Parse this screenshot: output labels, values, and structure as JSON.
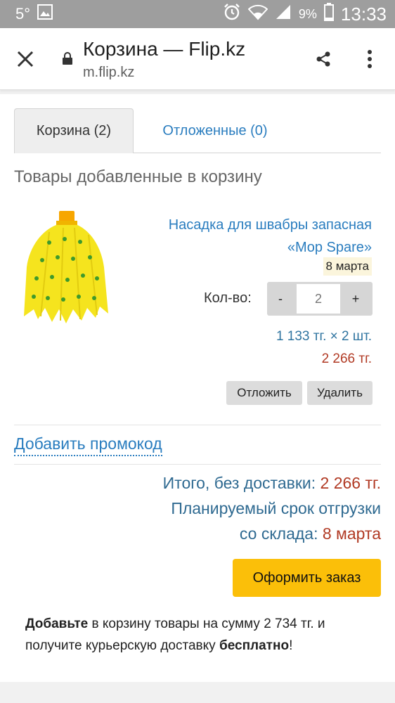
{
  "status_bar": {
    "temperature": "5°",
    "battery": "9%",
    "time": "13:33"
  },
  "header": {
    "title": "Корзина — Flip.kz",
    "url": "m.flip.kz"
  },
  "tabs": [
    {
      "label": "Корзина (2)",
      "active": true
    },
    {
      "label": "Отложенные (0)",
      "active": false
    }
  ],
  "cart": {
    "heading": "Товары добавленные в корзину",
    "items": [
      {
        "name": "Насадка для швабры запасная «Mop Spare»",
        "delivery_date": "8 марта",
        "qty_label": "Кол-во:",
        "qty_minus": "-",
        "qty_plus": "+",
        "quantity": "2",
        "unit_price_line": "1 133 тг. × 2 шт.",
        "line_total": "2 266 тг.",
        "postpone_label": "Отложить",
        "delete_label": "Удалить"
      }
    ]
  },
  "promo_link": "Добавить промокод",
  "summary": {
    "total_label": "Итого, без доставки:",
    "total_value": "2 266 тг.",
    "ship_label_1": "Планируемый срок отгрузки",
    "ship_label_2": "со склада:",
    "ship_value": "8 марта"
  },
  "checkout_label": "Оформить заказ",
  "free_delivery": {
    "bold_start": "Добавьте",
    "text_1": " в корзину товары на сумму 2 734 тг. и получите курьерскую доставку ",
    "bold_end": "бесплатно",
    "text_2": "!"
  },
  "colors": {
    "link": "#2a7dbf",
    "price_red": "#b13a24",
    "checkout_yellow": "#fbbf09",
    "status_bar": "#9e9e9e"
  }
}
